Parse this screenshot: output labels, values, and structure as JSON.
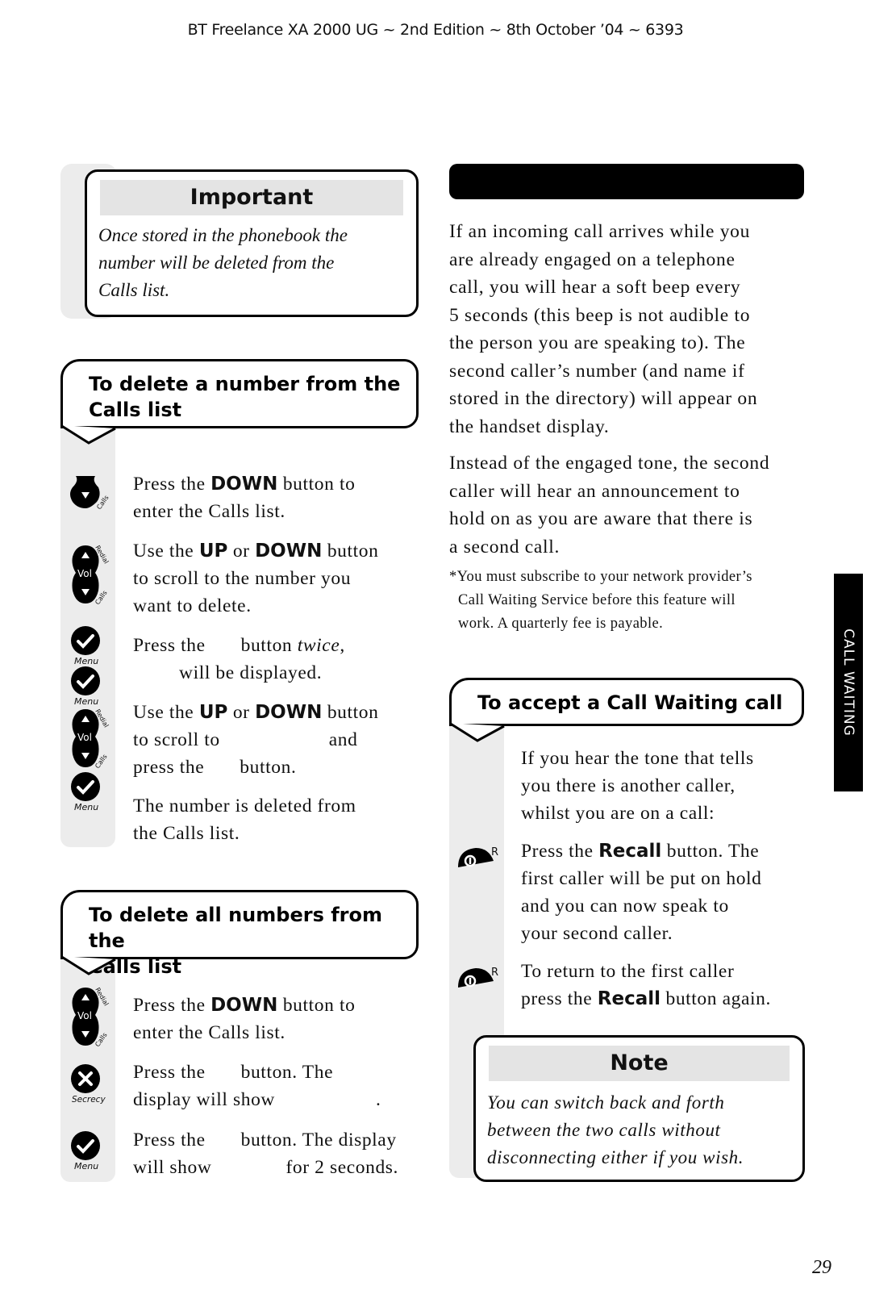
{
  "header": {
    "text": "BT Freelance XA 2000 UG ~ 2nd Edition ~ 8th October ’04 ~ 6393"
  },
  "important_box": {
    "title": "Important",
    "lines": [
      "Once stored in the phonebook the",
      "number will be deleted from  the",
      "Calls list."
    ]
  },
  "delete_one": {
    "heading_lines": [
      "To delete a number from the",
      "Calls list"
    ],
    "steps": [
      {
        "icon": "down-calls-button-icon",
        "parts": [
          [
            "Press the ",
            ""
          ],
          [
            "DOWN",
            "b"
          ],
          [
            " button to",
            ""
          ]
        ],
        "line2": "enter the Calls list."
      },
      {
        "icon": "vol-up-down-button-icon",
        "parts": [
          [
            "Use the ",
            ""
          ],
          [
            "UP",
            "b"
          ],
          [
            " or ",
            ""
          ],
          [
            "DOWN",
            "b"
          ],
          [
            " button",
            ""
          ]
        ],
        "line2": "to scroll to the number you",
        "line3": "want to delete."
      },
      {
        "icon": "menu-check-button-icon",
        "line1a": "Press the",
        "line1b": "button",
        "line1c": "twice",
        "line1d": ",",
        "line2": "will be displayed."
      },
      {
        "icon": "vol-up-down-button-icon",
        "parts": [
          [
            "Use the ",
            ""
          ],
          [
            "UP",
            "b"
          ],
          [
            " or ",
            ""
          ],
          [
            "DOWN",
            "b"
          ],
          [
            " button",
            ""
          ]
        ],
        "line2a": "to scroll to",
        "line2b": "and",
        "line3a": "press the",
        "line3b": "button."
      },
      {
        "line1": "The number is deleted from",
        "line2": "the Calls list."
      }
    ],
    "icon_labels": {
      "calls": "Calls",
      "redial": "Redial",
      "vol": "Vol",
      "menu": "Menu"
    }
  },
  "delete_all": {
    "heading_lines": [
      "To delete all numbers from the",
      "Calls list"
    ],
    "steps": [
      {
        "parts": [
          [
            "Press the ",
            ""
          ],
          [
            "DOWN",
            "b"
          ],
          [
            " button to",
            ""
          ]
        ],
        "line2": "enter the Calls list."
      },
      {
        "line1a": "Press the",
        "line1b": "button. The",
        "line2a": "display will show",
        "line2b": "."
      },
      {
        "line1a": "Press the",
        "line1b": "button. The display",
        "line2a": "will show",
        "line2b": "for 2 seconds."
      }
    ],
    "icon_labels": {
      "secrecy": "Secrecy",
      "menu": "Menu"
    }
  },
  "call_waiting_intro": {
    "para1": [
      "If an incoming call arrives while you",
      "are already engaged on a telephone",
      "call, you will hear a soft beep every",
      "5 seconds (this beep is not audible to",
      "the person you are speaking to). The",
      "second caller’s number (and name if",
      "stored in the directory) will appear on",
      "the handset display."
    ],
    "para2": [
      "Instead of the engaged tone, the second",
      "caller will hear an announcement to",
      "hold on as you are aware that there is",
      "a second call."
    ],
    "footnote": [
      "*You must subscribe to your network provider’s",
      "Call Waiting Service before this feature will",
      "work. A quarterly fee is payable."
    ]
  },
  "accept_call": {
    "heading": "To accept a Call Waiting call",
    "intro": [
      "If you hear the tone that tells",
      "you there is another caller,",
      "whilst you are on a call:"
    ],
    "step1": {
      "a": "Press the ",
      "b": "Recall",
      "c": " button. The",
      "lines": [
        "first caller will be put on hold",
        "and you can now speak to",
        "your second caller."
      ]
    },
    "step2": {
      "line1": "To return to the first caller",
      "a": "press the ",
      "b": "Recall",
      "c": " button again."
    },
    "recall_label": "R"
  },
  "note_box": {
    "title": "Note",
    "lines": [
      "You can switch back and forth",
      "between the two calls without",
      "disconnecting either if you wish."
    ]
  },
  "side_tab": {
    "label": "CALL WAITING"
  },
  "page_number": "29"
}
